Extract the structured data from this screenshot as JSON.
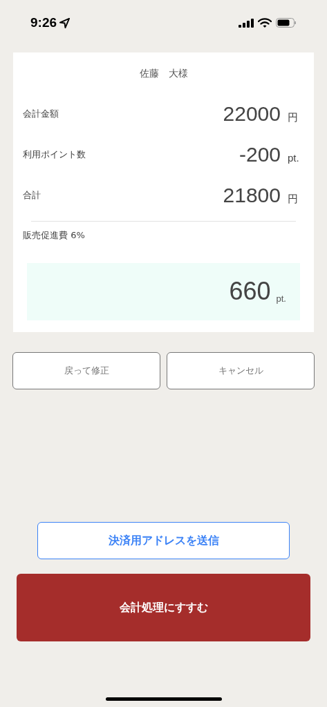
{
  "status_bar": {
    "time": "9:26"
  },
  "customer": {
    "name": "佐藤　大様"
  },
  "rows": [
    {
      "label": "会計金額",
      "value": "22000",
      "unit": "円"
    },
    {
      "label": "利用ポイント数",
      "value": "-200",
      "unit": "pt."
    },
    {
      "label": "合計",
      "value": "21800",
      "unit": "円"
    }
  ],
  "promotion": {
    "label": "販売促進費 6%",
    "value": "660",
    "unit": "pt."
  },
  "secondary_buttons": [
    "戻って修正",
    "キャンセル"
  ],
  "send_button": "決済用アドレスを送信",
  "primary_button": "会計処理にすすむ"
}
